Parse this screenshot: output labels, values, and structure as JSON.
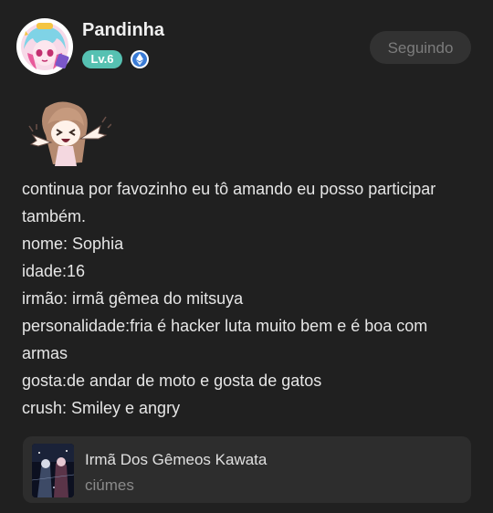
{
  "profile": {
    "username": "Pandinha",
    "level": "Lv.6",
    "follow_label": "Seguindo",
    "level_color": "#56c1b2"
  },
  "post": {
    "lines": [
      "continua por favozinho eu tô amando eu posso participar também.",
      "nome: Sophia",
      "idade:16",
      "irmão: irmã gêmea do mitsuya",
      "personalidade:fria é hacker luta muito bem e é boa com armas",
      "gosta:de andar de moto e gosta de gatos",
      "crush: Smiley e angry"
    ]
  },
  "link_card": {
    "title": "Irmã Dos Gêmeos Kawata",
    "subtitle": "ciúmes"
  }
}
